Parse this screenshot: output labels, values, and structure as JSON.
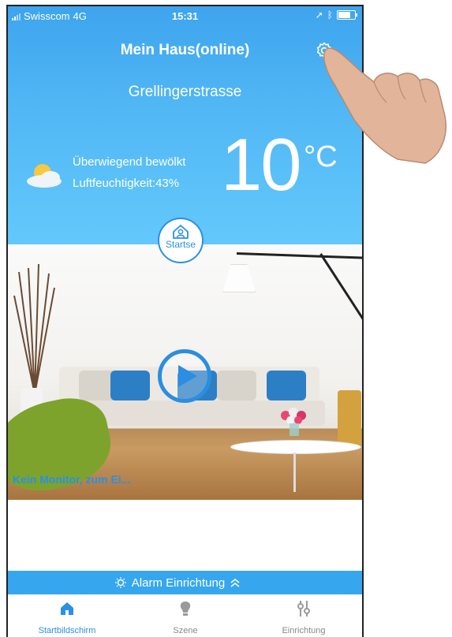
{
  "status_bar": {
    "carrier": "Swisscom",
    "network": "4G",
    "time": "15:31"
  },
  "header": {
    "title": "Mein Haus(online)",
    "street": "Grellingerstrasse"
  },
  "weather": {
    "description": "Überwiegend bewölkt",
    "humidity": "Luftfeuchtigkeit:43%",
    "temperature": "10",
    "unit": "°C"
  },
  "home_button": {
    "label": "Startse"
  },
  "monitor": {
    "text": "Kein Monitor, zum Ei..."
  },
  "alarm": {
    "label": "Alarm Einrichtung"
  },
  "tabs": [
    {
      "label": "Startbildschirm",
      "icon": "home-icon",
      "active": true
    },
    {
      "label": "Szene",
      "icon": "bulb-icon",
      "active": false
    },
    {
      "label": "Einrichtung",
      "icon": "sliders-icon",
      "active": false
    }
  ],
  "colors": {
    "accent": "#2a8fe6",
    "header_top": "#3ea4ee",
    "header_bottom": "#63c8fb",
    "alarm_bar": "#36a7ee"
  }
}
